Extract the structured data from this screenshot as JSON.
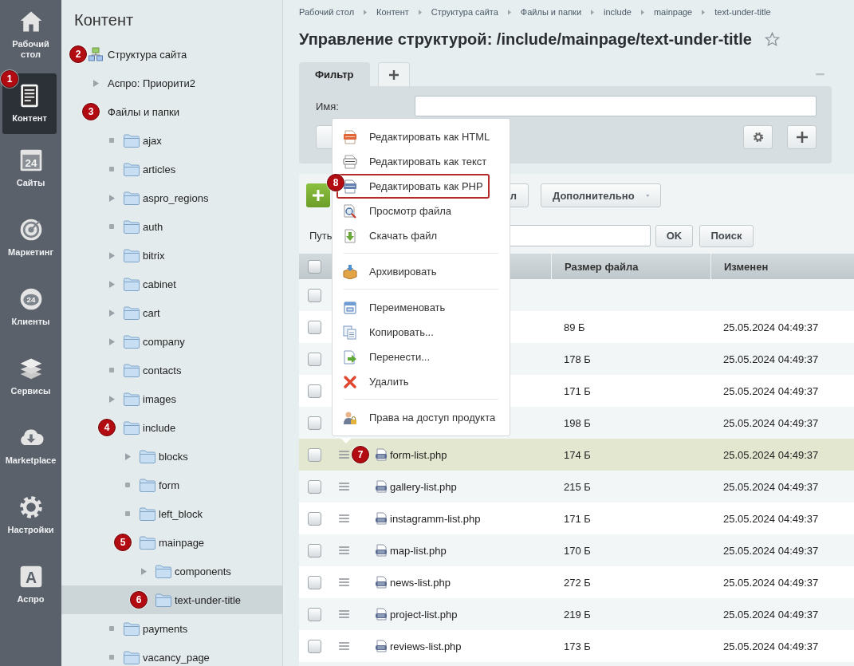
{
  "nav": [
    {
      "label": "Рабочий стол",
      "kind": "home",
      "selected": false
    },
    {
      "label": "Контент",
      "kind": "document",
      "selected": true,
      "badge": "1"
    },
    {
      "label": "Сайты",
      "kind": "calendar",
      "glyph": "24",
      "selected": false
    },
    {
      "label": "Маркетинг",
      "kind": "target",
      "selected": false
    },
    {
      "label": "Клиенты",
      "kind": "cloud",
      "glyph": "24",
      "selected": false
    },
    {
      "label": "Сервисы",
      "kind": "layers",
      "selected": false
    },
    {
      "label": "Marketplace",
      "kind": "download",
      "selected": false
    },
    {
      "label": "Настройки",
      "kind": "gear",
      "selected": false
    },
    {
      "label": "Аспро",
      "kind": "tile",
      "glyph": "A",
      "selected": false
    }
  ],
  "tree": {
    "title": "Контент",
    "items": [
      {
        "label": "Структура сайта",
        "kind": "site",
        "badge": "2",
        "selected": false
      },
      {
        "label": "Аспро: Приорити2",
        "kind": "branch",
        "selected": false
      },
      {
        "label": "Файлы и папки",
        "kind": "open",
        "badge": "3",
        "selected": false,
        "children": [
          {
            "label": "ajax",
            "kind": "leaf",
            "selected": false
          },
          {
            "label": "articles",
            "kind": "leaf",
            "selected": false
          },
          {
            "label": "aspro_regions",
            "kind": "branch",
            "selected": false
          },
          {
            "label": "auth",
            "kind": "leaf",
            "selected": false
          },
          {
            "label": "bitrix",
            "kind": "branch",
            "selected": false
          },
          {
            "label": "cabinet",
            "kind": "branch",
            "selected": false
          },
          {
            "label": "cart",
            "kind": "branch",
            "selected": false
          },
          {
            "label": "company",
            "kind": "branch",
            "selected": false
          },
          {
            "label": "contacts",
            "kind": "leaf",
            "selected": false
          },
          {
            "label": "images",
            "kind": "branch",
            "selected": false
          },
          {
            "label": "include",
            "kind": "open",
            "badge": "4",
            "selected": false,
            "children": [
              {
                "label": "blocks",
                "kind": "branch",
                "selected": false
              },
              {
                "label": "form",
                "kind": "leaf",
                "selected": false
              },
              {
                "label": "left_block",
                "kind": "leaf",
                "selected": false
              },
              {
                "label": "mainpage",
                "kind": "open",
                "badge": "5",
                "selected": false,
                "children": [
                  {
                    "label": "components",
                    "kind": "branch",
                    "selected": false
                  },
                  {
                    "label": "text-under-title",
                    "kind": "open",
                    "badge": "6",
                    "selected": true
                  }
                ]
              }
            ]
          },
          {
            "label": "payments",
            "kind": "leaf",
            "selected": false
          },
          {
            "label": "vacancy_page",
            "kind": "leaf",
            "selected": false
          }
        ]
      }
    ]
  },
  "breadcrumbs": [
    "Рабочий стол",
    "Контент",
    "Структура сайта",
    "Файлы и папки",
    "include",
    "mainpage",
    "text-under-title"
  ],
  "title": "Управление структурой: /include/mainpage/text-under-title",
  "favorite": false,
  "filter": {
    "tabs": [
      {
        "label": "Фильтр",
        "kind": "text",
        "selected": true
      },
      {
        "kind": "add",
        "selected": false
      }
    ],
    "field_label": "Имя:"
  },
  "toolbar": {
    "hidden_button": "л",
    "more": "Дополнительно"
  },
  "path": {
    "label": "Путь",
    "ok": "OK",
    "search": "Поиск"
  },
  "table": {
    "columns": [
      "Размер файла",
      "Изменен"
    ],
    "header_checked": false,
    "rows": [
      {
        "checked": false,
        "selected": false
      },
      {
        "size": "89 Б",
        "changed": "25.05.2024 04:49:37",
        "checked": false,
        "selected": false
      },
      {
        "size": "178 Б",
        "changed": "25.05.2024 04:49:37",
        "checked": false,
        "selected": false
      },
      {
        "size": "171 Б",
        "changed": "25.05.2024 04:49:37",
        "checked": false,
        "selected": false
      },
      {
        "size": "198 Б",
        "changed": "25.05.2024 04:49:37",
        "checked": false,
        "selected": false
      },
      {
        "name": "form-list.php",
        "size": "174 Б",
        "changed": "25.05.2024 04:49:37",
        "checked": false,
        "selected": true,
        "badge": "7"
      },
      {
        "name": "gallery-list.php",
        "size": "215 Б",
        "changed": "25.05.2024 04:49:37",
        "checked": false,
        "selected": false
      },
      {
        "name": "instagramm-list.php",
        "size": "171 Б",
        "changed": "25.05.2024 04:49:37",
        "checked": false,
        "selected": false
      },
      {
        "name": "map-list.php",
        "size": "170 Б",
        "changed": "25.05.2024 04:49:37",
        "checked": false,
        "selected": false
      },
      {
        "name": "news-list.php",
        "size": "272 Б",
        "changed": "25.05.2024 04:49:37",
        "checked": false,
        "selected": false
      },
      {
        "name": "project-list.php",
        "size": "219 Б",
        "changed": "25.05.2024 04:49:37",
        "checked": false,
        "selected": false
      },
      {
        "name": "reviews-list.php",
        "size": "173 Б",
        "changed": "25.05.2024 04:49:37",
        "checked": false,
        "selected": false
      }
    ]
  },
  "menu": [
    {
      "kind": "item",
      "label": "Редактировать как HTML",
      "highlighted": false
    },
    {
      "kind": "item",
      "label": "Редактировать как текст",
      "highlighted": false
    },
    {
      "kind": "item",
      "label": "Редактировать как PHP",
      "highlighted": true,
      "badge": "8"
    },
    {
      "kind": "item",
      "label": "Просмотр файла",
      "highlighted": false
    },
    {
      "kind": "item",
      "label": "Скачать файл",
      "highlighted": false
    },
    {
      "kind": "separator"
    },
    {
      "kind": "item",
      "label": "Архивировать",
      "highlighted": false
    },
    {
      "kind": "separator"
    },
    {
      "kind": "item",
      "label": "Переименовать",
      "highlighted": false
    },
    {
      "kind": "item",
      "label": "Копировать...",
      "highlighted": false
    },
    {
      "kind": "item",
      "label": "Перенести...",
      "highlighted": false
    },
    {
      "kind": "item",
      "label": "Удалить",
      "highlighted": false
    },
    {
      "kind": "separator"
    },
    {
      "kind": "item",
      "label": "Права на доступ продукта",
      "highlighted": false
    }
  ]
}
